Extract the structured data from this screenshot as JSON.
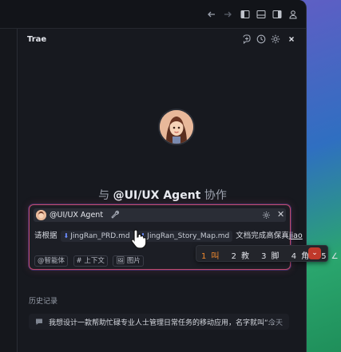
{
  "panel": {
    "title": "Trae"
  },
  "hero": {
    "prefix": "与",
    "agent": "@UI/UX Agent",
    "suffix": "协作"
  },
  "chat": {
    "agent_label": "@UI/UX Agent",
    "input_prefix": "请根据",
    "file1": "JingRan_PRD.md",
    "file2": "JingRan_Story_Map.md",
    "input_suffix": "文档完成高保真",
    "typing": "jiao",
    "tools": [
      "@智能体",
      "# 上下文",
      "图片"
    ]
  },
  "ime": {
    "candidates": [
      {
        "index": "1",
        "text": "叫"
      },
      {
        "index": "2",
        "text": "教"
      },
      {
        "index": "3",
        "text": "脚"
      },
      {
        "index": "4",
        "text": "角"
      },
      {
        "index": "5",
        "text": "∠"
      }
    ]
  },
  "history": {
    "label": "历史记录",
    "items": [
      {
        "text": "我想设计一款帮助忙碌专业人士管理日常任务的移动应用，名字就叫“...",
        "time": "今天"
      }
    ]
  },
  "colors": {
    "accent_border": "#c04a68",
    "ime_selected": "#f28a2e",
    "file_icon": "#6b8cff"
  }
}
